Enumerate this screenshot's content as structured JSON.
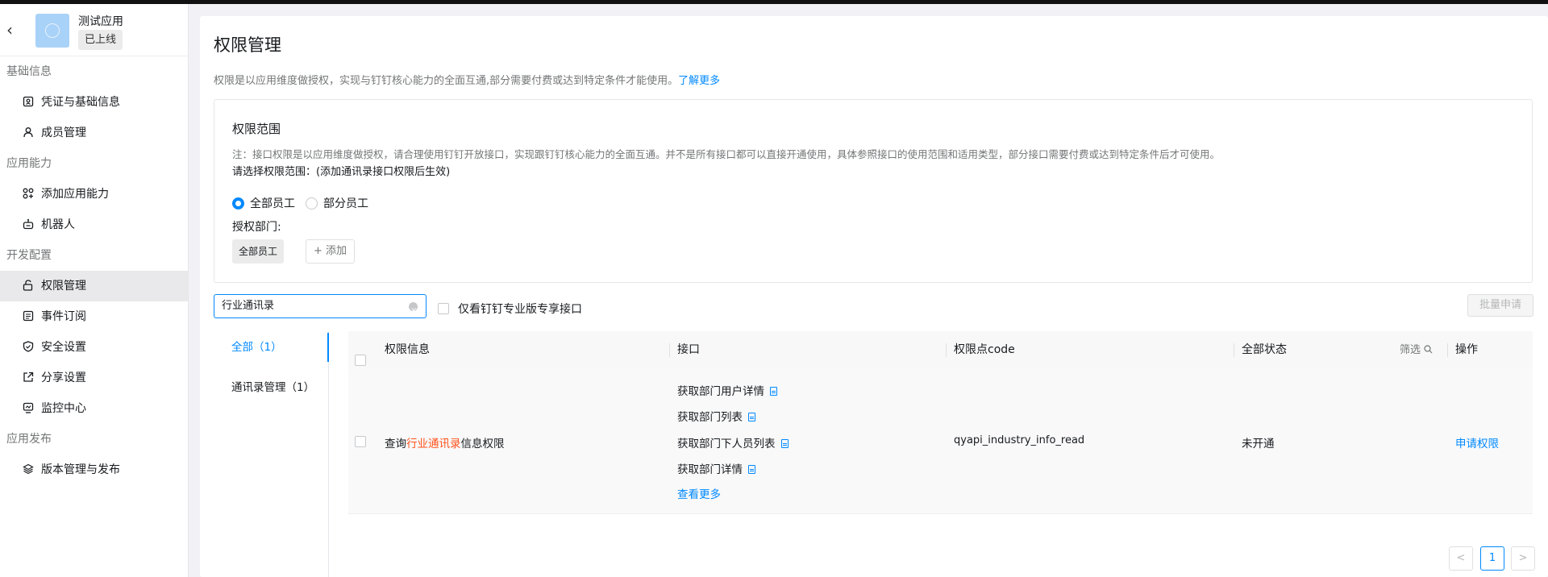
{
  "app": {
    "name": "测试应用",
    "status": "已上线"
  },
  "sidebar": {
    "groups": [
      {
        "title": "基础信息",
        "items": [
          {
            "label": "凭证与基础信息",
            "icon": "credential-icon"
          },
          {
            "label": "成员管理",
            "icon": "user-icon"
          }
        ]
      },
      {
        "title": "应用能力",
        "items": [
          {
            "label": "添加应用能力",
            "icon": "apps-icon"
          },
          {
            "label": "机器人",
            "icon": "robot-icon"
          }
        ]
      },
      {
        "title": "开发配置",
        "items": [
          {
            "label": "权限管理",
            "icon": "lock-icon",
            "active": true
          },
          {
            "label": "事件订阅",
            "icon": "event-icon"
          },
          {
            "label": "安全设置",
            "icon": "shield-icon"
          },
          {
            "label": "分享设置",
            "icon": "share-icon"
          },
          {
            "label": "监控中心",
            "icon": "monitor-icon"
          }
        ]
      },
      {
        "title": "应用发布",
        "items": [
          {
            "label": "版本管理与发布",
            "icon": "layers-icon"
          }
        ]
      }
    ]
  },
  "page": {
    "title": "权限管理",
    "desc": "权限是以应用维度做授权，实现与钉钉核心能力的全面互通,部分需要付费或达到特定条件才能使用。",
    "learn_more": "了解更多"
  },
  "scope": {
    "title": "权限范围",
    "note": "注：接口权限是以应用维度做授权，请合理使用钉钉开放接口，实现跟钉钉核心能力的全面互通。并不是所有接口都可以直接开通使用，具体参照接口的使用范围和适用类型，部分接口需要付费或达到特定条件后才可使用。",
    "select_label": "请选择权限范围：(添加通讯录接口权限后生效)",
    "options": [
      "全部员工",
      "部分员工"
    ],
    "selected": "全部员工",
    "dept_label": "授权部门:",
    "dept_tag": "全部员工",
    "add_label": "+ 添加"
  },
  "search": {
    "value": "行业通讯录"
  },
  "pro_filter_label": "仅看钉钉专业版专享接口",
  "batch_apply": "批量申请",
  "categories": [
    {
      "label": "全部（1）",
      "active": true
    },
    {
      "label": "通讯录管理（1）"
    }
  ],
  "table": {
    "headers": {
      "info": "权限信息",
      "api": "接口",
      "code": "权限点code",
      "status": "全部状态",
      "filter": "筛选",
      "action": "操作"
    },
    "rows": [
      {
        "info_prefix": "查询",
        "info_highlight": "行业通讯录",
        "info_suffix": "信息权限",
        "apis": [
          "获取部门用户详情",
          "获取部门列表",
          "获取部门下人员列表",
          "获取部门详情"
        ],
        "more": "查看更多",
        "code": "qyapi_industry_info_read",
        "status": "未开通",
        "action": "申请权限"
      }
    ]
  },
  "pagination": {
    "prev": "<",
    "current": "1",
    "next": ">"
  }
}
